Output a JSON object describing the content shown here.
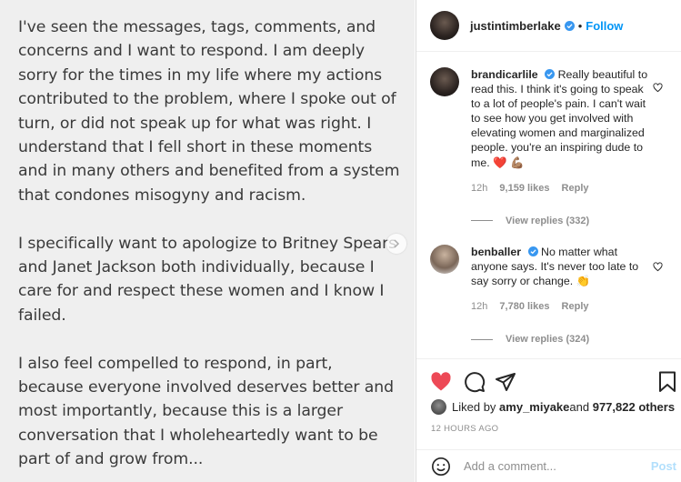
{
  "post_image": {
    "paragraphs": [
      "I've seen the messages, tags, comments, and concerns and I want to respond. I am deeply sorry for the times in my life where my actions contributed to the problem, where I spoke out of turn, or did not speak up for what was right. I understand that I fell short in these moments and in many others and benefited from a system that condones misogyny and racism.",
      "I specifically want to apologize to Britney Spears and Janet Jackson both individually, because I care for and respect these women and I know I failed.",
      "I also feel compelled to respond, in part, because everyone involved deserves better and most importantly, because this is a larger conversation that I wholeheartedly want to be part of and grow from..."
    ]
  },
  "header": {
    "username": "justintimberlake",
    "separator": "•",
    "follow_label": "Follow"
  },
  "comments": [
    {
      "username": "brandicarlile",
      "text": "Really beautiful to read this. I think it's going to speak to a lot of people's pain. I can't wait to see how you get involved with elevating women and marginalized people. you're an inspiring dude to me. ❤️ 💪🏽",
      "time": "12h",
      "likes": "9,159 likes",
      "reply_label": "Reply",
      "view_replies": "View replies (332)"
    },
    {
      "username": "benballer",
      "text": "No matter what anyone says. It's never too late to say sorry or change. 👏",
      "time": "12h",
      "likes": "7,780 likes",
      "reply_label": "Reply",
      "view_replies": "View replies (324)"
    }
  ],
  "likes_row": {
    "prefix": "Liked by ",
    "user": "amy_miyake",
    "middle": " and ",
    "others": "977,822 others"
  },
  "timestamp": "12 HOURS AGO",
  "add_comment": {
    "placeholder": "Add a comment...",
    "post_label": "Post"
  },
  "colors": {
    "accent": "#0095f6",
    "like_red": "#ed4956",
    "post_disabled": "#b2dffc"
  }
}
